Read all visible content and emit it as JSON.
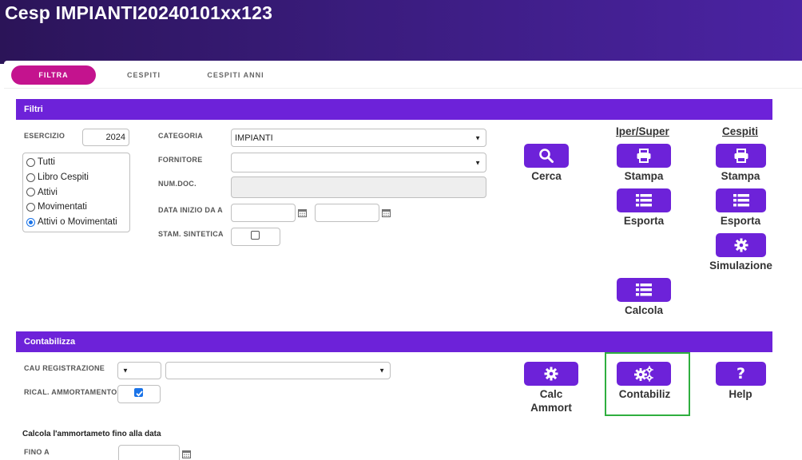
{
  "app": {
    "title": "Cesp IMPIANTI20240101xx123"
  },
  "tabs": [
    {
      "label": "FILTRA",
      "active": true
    },
    {
      "label": "CESPITI",
      "active": false
    },
    {
      "label": "CESPITI ANNI",
      "active": false
    }
  ],
  "filtri": {
    "title": "Filtri",
    "esercizio": {
      "label": "ESERCIZIO",
      "value": "2024"
    },
    "radio_options": [
      {
        "label": "Tutti",
        "selected": false
      },
      {
        "label": "Libro Cespiti",
        "selected": false
      },
      {
        "label": "Attivi",
        "selected": false
      },
      {
        "label": "Movimentati",
        "selected": false
      },
      {
        "label": "Attivi o Movimentati",
        "selected": true
      }
    ],
    "categoria": {
      "label": "CATEGORIA",
      "value": "IMPIANTI"
    },
    "fornitore": {
      "label": "FORNITORE",
      "value": ""
    },
    "num_doc": {
      "label": "NUM.DOC.",
      "value": ""
    },
    "data_inizio": {
      "label": "DATA INIZIO DA A",
      "from": "",
      "to": ""
    },
    "stam_sintetica": {
      "label": "STAM. SINTETICA",
      "checked": false
    }
  },
  "actions": {
    "cerca": {
      "label": "Cerca",
      "icon": "search-icon"
    },
    "iper_super": {
      "title": "Iper/Super",
      "stampa": {
        "label": "Stampa",
        "icon": "printer-icon"
      },
      "esporta": {
        "label": "Esporta",
        "icon": "list-icon"
      },
      "calcola": {
        "label": "Calcola",
        "icon": "list-icon"
      }
    },
    "cespiti": {
      "title": "Cespiti",
      "stampa": {
        "label": "Stampa",
        "icon": "printer-icon"
      },
      "esporta": {
        "label": "Esporta",
        "icon": "list-icon"
      },
      "simulazione": {
        "label": "Simulazione",
        "icon": "gear-icon"
      }
    }
  },
  "contabilizza": {
    "title": "Contabilizza",
    "cau_registrazione": {
      "label": "CAU REGISTRAZIONE",
      "code": "",
      "description": ""
    },
    "rical_ammortamento": {
      "label": "RICAL. AMMORTAMENTO",
      "checked": true
    },
    "calc_ammort": {
      "label_line1": "Calc",
      "label_line2": "Ammort",
      "icon": "gear-icon"
    },
    "contabiliz": {
      "label": "Contabiliz",
      "icon": "gears-icon"
    },
    "help": {
      "label": "Help",
      "icon": "question-icon"
    },
    "note": "Calcola l'ammortameto fino alla data",
    "fino_a": {
      "label": "FINO A",
      "value": ""
    }
  },
  "colors": {
    "header_dark": "#2b1458",
    "accent_purple": "#6d22d9",
    "tab_active": "#c4138e",
    "highlight_green": "#2fae3f",
    "checkbox_blue": "#1a73e8"
  }
}
